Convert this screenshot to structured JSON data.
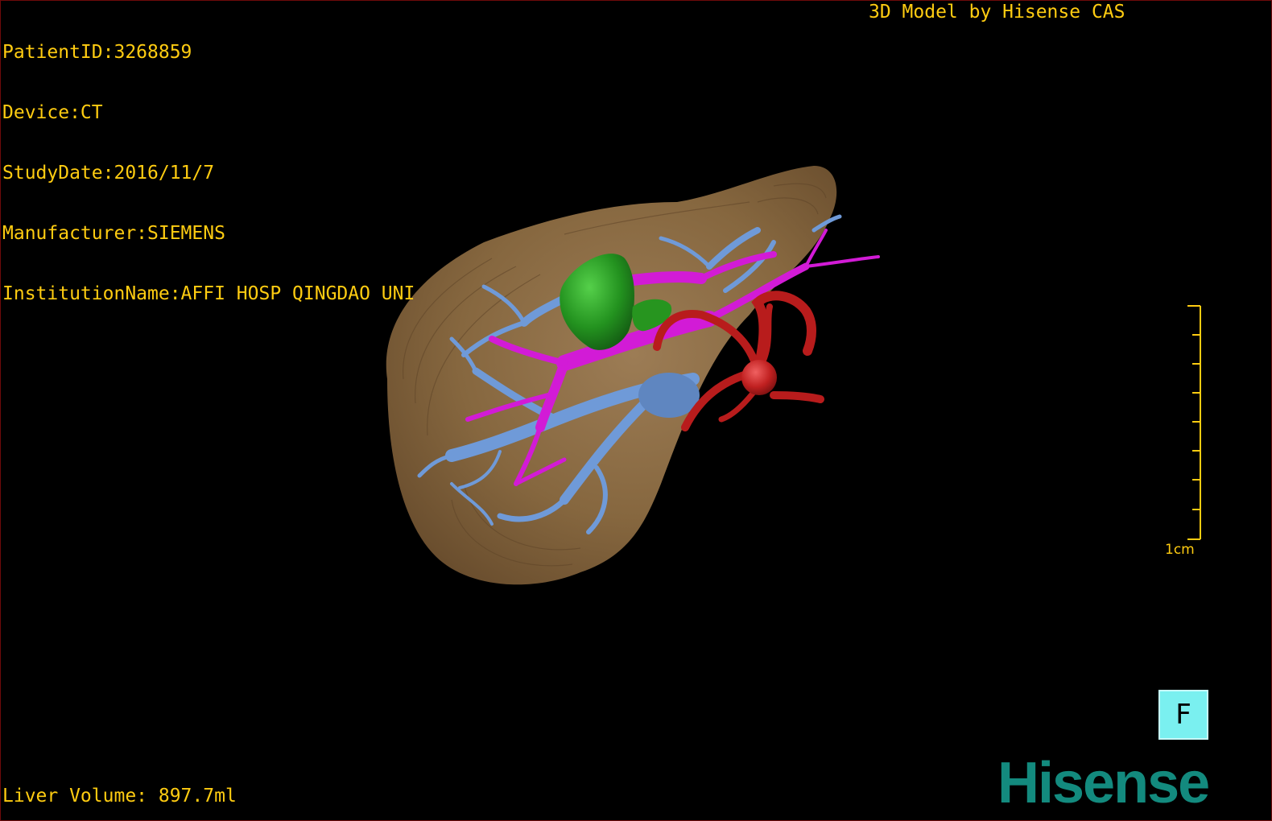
{
  "app_title": "3D Model by Hisense CAS",
  "patient_info": [
    "PatientID:3268859",
    "Device:CT",
    "StudyDate:2016/11/7",
    "Manufacturer:SIEMENS",
    "InstitutionName:AFFI HOSP QINGDAO UNI"
  ],
  "liver_volume": "Liver Volume: 897.7ml",
  "scale": {
    "label": "1cm",
    "color": "#ffcc11"
  },
  "orientation": {
    "label": "F",
    "color": "#7af0f0"
  },
  "brand": {
    "name": "Hisense",
    "color": "#138a7e"
  },
  "model_colors": {
    "liver": "#8a6a44",
    "portal_vein": "#6f9ad8",
    "hepatic_vein": "#d21bd6",
    "tumor": "#2a9a26",
    "artery": "#b81c1c"
  },
  "text_color": "#ffcc11"
}
